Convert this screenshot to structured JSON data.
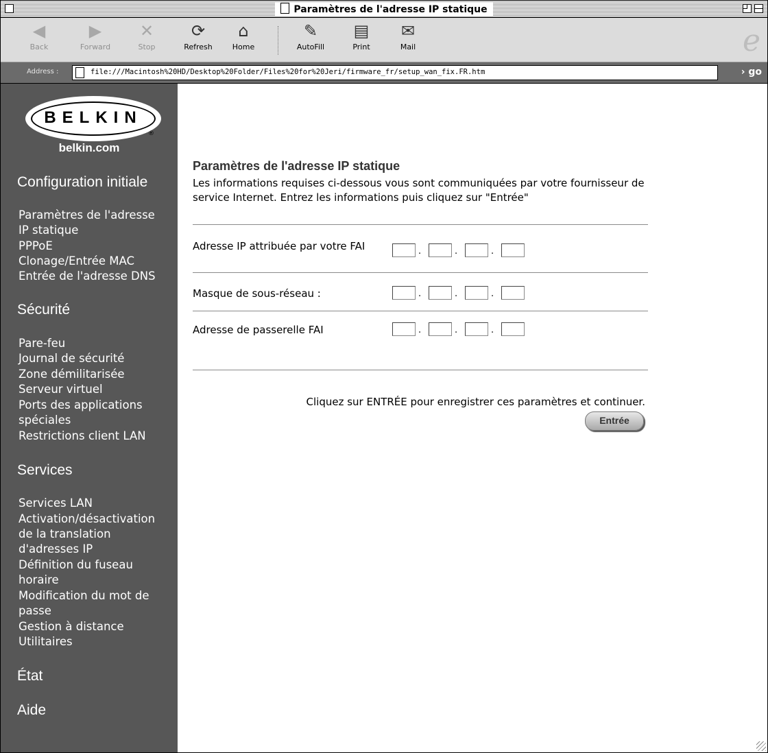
{
  "window": {
    "title": "Paramètres de l'adresse IP statique"
  },
  "toolbar": {
    "buttons": [
      {
        "label": "Back",
        "icon": "back-arrow-icon",
        "enabled": false
      },
      {
        "label": "Forward",
        "icon": "forward-arrow-icon",
        "enabled": false
      },
      {
        "label": "Stop",
        "icon": "stop-x-icon",
        "enabled": false
      },
      {
        "label": "Refresh",
        "icon": "refresh-icon",
        "enabled": true
      },
      {
        "label": "Home",
        "icon": "home-icon",
        "enabled": true
      },
      {
        "label": "AutoFill",
        "icon": "autofill-icon",
        "enabled": true
      },
      {
        "label": "Print",
        "icon": "printer-icon",
        "enabled": true
      },
      {
        "label": "Mail",
        "icon": "mail-icon",
        "enabled": true
      }
    ]
  },
  "address_bar": {
    "label": "Address :",
    "url": "file:///Macintosh%20HD/Desktop%20Folder/Files%20for%20Jeri/firmware_fr/setup_wan_fix.FR.htm",
    "go_label": "› go"
  },
  "sidebar": {
    "logo_text": "BELKIN",
    "logo_reg": "®",
    "site": "belkin.com",
    "sections": [
      {
        "heading": "Configuration initiale",
        "items": [
          "Paramètres de l'adresse",
          "IP statique",
          "PPPoE",
          "Clonage/Entrée MAC",
          "Entrée de l'adresse DNS"
        ]
      },
      {
        "heading": "Sécurité",
        "items": [
          "Pare-feu",
          "Journal de sécurité",
          "Zone démilitarisée",
          "Serveur virtuel",
          "Ports des applications",
          "spéciales",
          "Restrictions client LAN"
        ]
      },
      {
        "heading": "Services",
        "items": [
          "Services LAN",
          "Activation/désactivation",
          "de la translation",
          "d'adresses IP",
          "Définition du fuseau",
          "horaire",
          "Modification du mot de",
          "passe",
          "Gestion à distance",
          "Utilitaires"
        ]
      },
      {
        "heading": "État",
        "items": []
      },
      {
        "heading": "Aide",
        "items": []
      }
    ]
  },
  "main": {
    "title": "Paramètres de l'adresse IP statique",
    "description": "Les informations requises ci-dessous vous sont communiquées par votre fournisseur de service Internet. Entrez les informations puis cliquez sur \"Entrée\"",
    "fields": [
      {
        "label": "Adresse IP attribuée par votre FAI",
        "octets": [
          "",
          "",
          "",
          ""
        ]
      },
      {
        "label": "Masque de sous-réseau :",
        "octets": [
          "",
          "",
          "",
          ""
        ]
      },
      {
        "label": "Adresse de passerelle FAI",
        "octets": [
          "",
          "",
          "",
          ""
        ]
      }
    ],
    "save_note": "Cliquez sur ENTRÉE pour enregistrer ces paramètres et continuer.",
    "enter_button": "Entrée"
  }
}
